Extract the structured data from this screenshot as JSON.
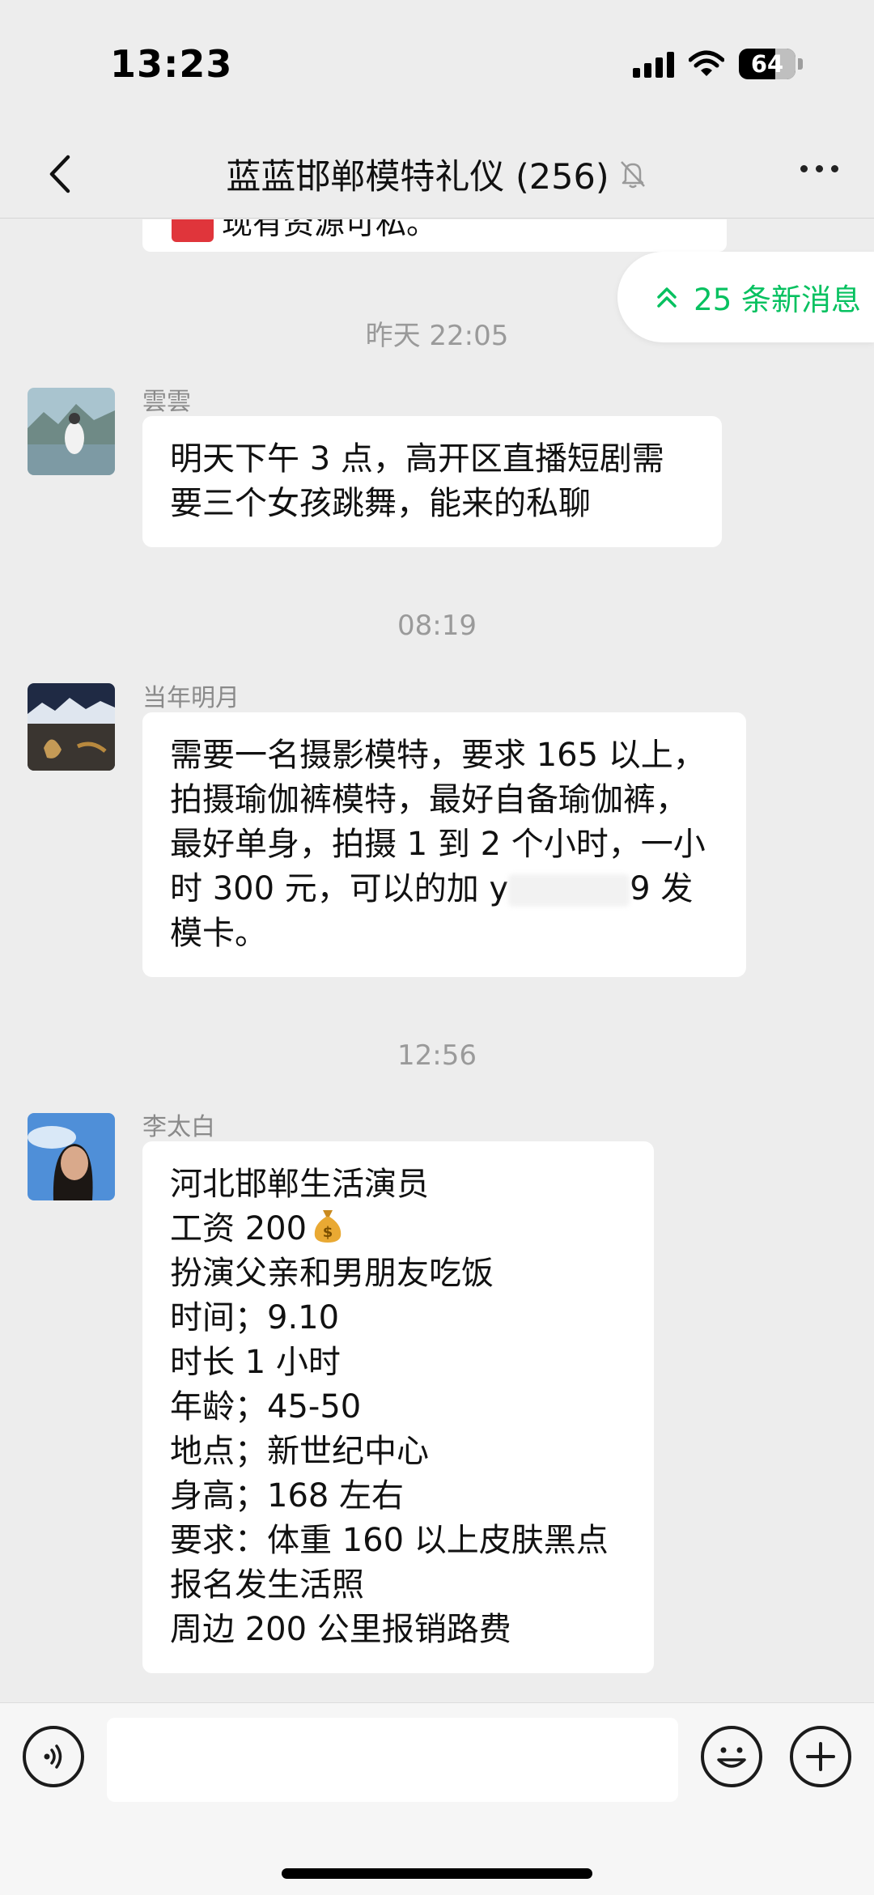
{
  "status_bar": {
    "time": "13:23",
    "battery": "64",
    "battery_level": 0.64,
    "icons": [
      "signal-icon",
      "wifi-icon",
      "battery-icon"
    ]
  },
  "nav": {
    "title": "蓝蓝邯郸模特礼仪 (256)",
    "icons": [
      "back-icon",
      "mute-bell-icon",
      "more-icon"
    ]
  },
  "chat": {
    "partial_message": "现有资源可私。",
    "new_messages_label": "25 条新消息",
    "accent_color": "#07c160",
    "messages": [
      {
        "timestamp": "昨天 22:05",
        "sender": "雲雲",
        "lines": [
          "明天下午 3 点，高开区直播短剧需",
          "要三个女孩跳舞，能来的私聊"
        ]
      },
      {
        "timestamp": "08:19",
        "sender": "当年明月",
        "lines": [
          "需要一名摄影模特，要求 165 以上，",
          "拍摄瑜伽裤模特，最好自备瑜伽裤，",
          "最好单身，拍摄 1 到 2 个小时，一小",
          "时 300 元，可以的加 y",
          "9 发",
          "模卡。"
        ]
      },
      {
        "timestamp": "12:56",
        "sender": "李太白",
        "lines": [
          "河北邯郸生活演员",
          "工资 200",
          "扮演父亲和男朋友吃饭",
          "时间；9.10",
          "时长 1 小时",
          "年龄；45-50",
          "地点；新世纪中心",
          "身高；168 左右",
          "要求：体重 160 以上皮肤黑点",
          "报名发生活照",
          "周边 200 公里报销路费"
        ]
      }
    ]
  },
  "input_bar": {
    "icons": [
      "voice-icon",
      "emoji-icon",
      "plus-icon"
    ]
  }
}
